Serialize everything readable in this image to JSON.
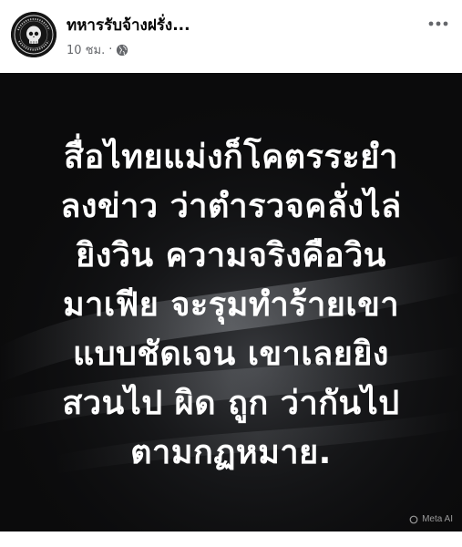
{
  "post": {
    "page_name": "ทหารรับจ้างฝรั่ง...",
    "time": "10 ชม.",
    "separator": "·",
    "privacy_icon": "globe-icon",
    "more_icon": "more-options-icon"
  },
  "image": {
    "lines": [
      "สื่อไทยแม่งก็โคตรระยำ",
      "ลงข่าว ว่าตำรวจคลั่งไล่",
      "ยิงวิน ความจริงคือวิน",
      "มาเฟีย จะรุมทำร้ายเขา",
      "แบบชัดเจน เขาเลยยิง",
      "สวนไป ผิด ถูก ว่ากันไป",
      "ตามกฏหมาย."
    ],
    "watermark": "Meta AI",
    "text_color": "#ffffff",
    "background_color": "#0b0b0c"
  }
}
